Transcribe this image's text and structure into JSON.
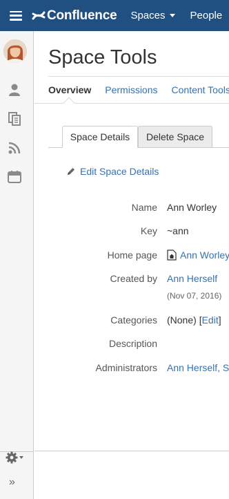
{
  "header": {
    "logo_text": "Confluence",
    "nav_spaces": "Spaces",
    "nav_people": "People",
    "bg_color": "#205081"
  },
  "sidebar": {
    "icons": [
      "profile-icon",
      "pages-icon",
      "feed-icon",
      "calendar-icon"
    ],
    "settings_icon": "gear-icon",
    "expand_label": "»"
  },
  "page": {
    "title": "Space Tools"
  },
  "tabs": [
    {
      "label": "Overview",
      "active": true
    },
    {
      "label": "Permissions",
      "active": false
    },
    {
      "label": "Content Tools",
      "active": false
    }
  ],
  "subtabs": [
    {
      "label": "Space Details",
      "active": true
    },
    {
      "label": "Delete Space",
      "active": false
    }
  ],
  "edit_link": "Edit Space Details",
  "details": {
    "name": {
      "label": "Name",
      "value": "Ann Worley"
    },
    "key": {
      "label": "Key",
      "value": "~ann"
    },
    "home_page": {
      "label": "Home page",
      "value": "Ann Worley"
    },
    "created_by": {
      "label": "Created by",
      "value": "Ann Herself",
      "date": "(Nov 07, 2016)"
    },
    "categories": {
      "label": "Categories",
      "value": "(None)",
      "edit_prefix": "[",
      "edit_label": "Edit",
      "edit_suffix": "]"
    },
    "description": {
      "label": "Description",
      "value": ""
    },
    "administrators": {
      "label": "Administrators",
      "value": "Ann Herself",
      "more": ", S"
    }
  },
  "colors": {
    "link": "#3572b0",
    "sidebar_bg": "#f5f5f5"
  }
}
